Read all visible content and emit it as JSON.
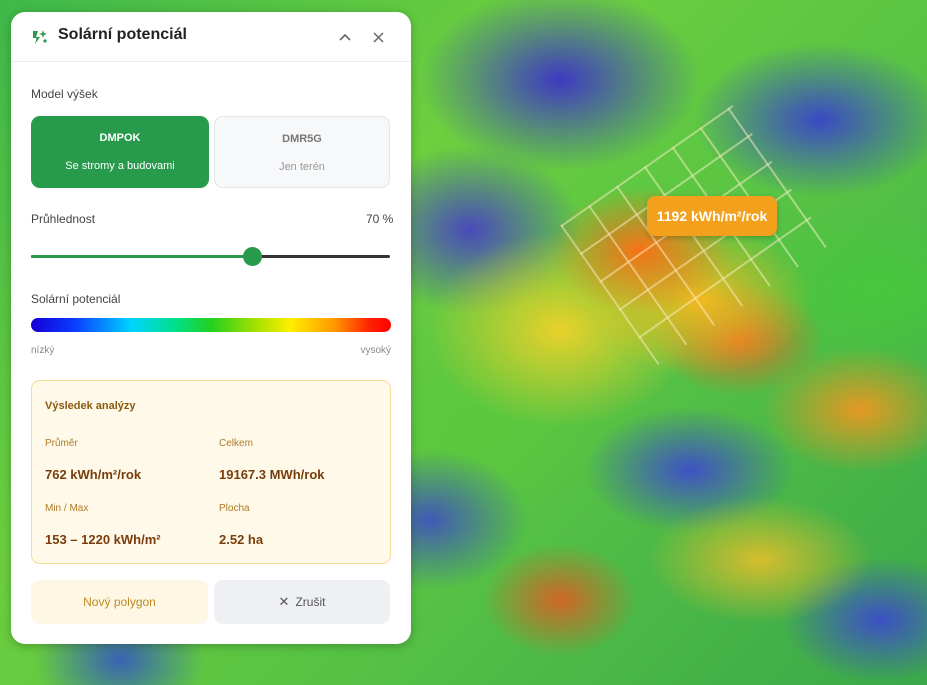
{
  "panel": {
    "title": "Solární potenciál",
    "height_model_label": "Model výšek",
    "models": [
      {
        "code": "DMPOK",
        "desc": "Se stromy a budovami",
        "active": true
      },
      {
        "code": "DMR5G",
        "desc": "Jen terén",
        "active": false
      }
    ],
    "opacity": {
      "label": "Průhlednost",
      "value_text": "70 %",
      "value": 0.7
    },
    "legend": {
      "label": "Solární potenciál",
      "low": "nízký",
      "high": "vysoký"
    },
    "result": {
      "title": "Výsledek analýzy",
      "average": {
        "label": "Průměr",
        "value": "762 kWh/m²/rok"
      },
      "total": {
        "label": "Celkem",
        "value": "19167.3 MWh/rok"
      },
      "minmax": {
        "label": "Min / Max",
        "value": "153 – 1220 kWh/m²"
      },
      "area": {
        "label": "Plocha",
        "value": "2.52 ha"
      }
    },
    "buttons": {
      "new_polygon": "Nový polygon",
      "cancel": "Zrušit"
    }
  },
  "map": {
    "tooltip": "1192 kWh/m²/rok"
  },
  "colors": {
    "accent": "#279a4b",
    "tooltip": "#f3a11c",
    "result_bg": "#fef9e8"
  }
}
